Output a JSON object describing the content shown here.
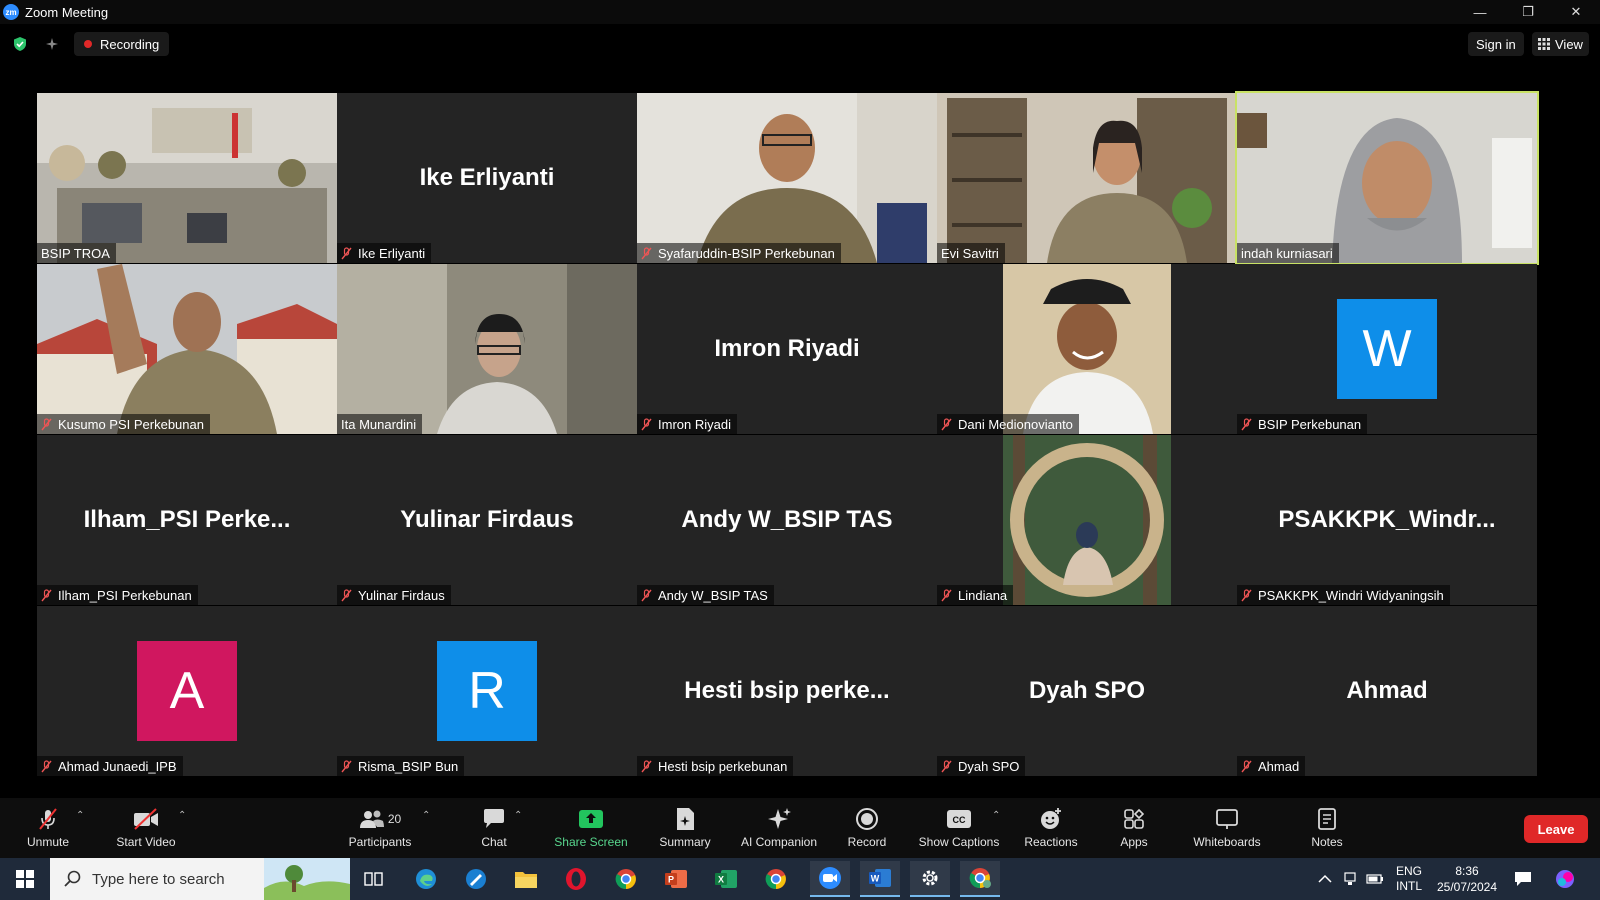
{
  "window": {
    "logo_text": "zm",
    "title": "Zoom Meeting",
    "minimize": "—",
    "restore": "❐",
    "close": "✕"
  },
  "topbar": {
    "security_icon": "shield-check-icon",
    "recording_label": "Recording",
    "sign_in": "Sign in",
    "view_label": "View"
  },
  "colors": {
    "active_speaker_border": "#c9e265",
    "avatar_A": "#d0175f",
    "avatar_blue": "#0e8ee9",
    "leave": "#e02828",
    "share_green": "#22c55e"
  },
  "participants": [
    {
      "name": "BSIP TROA",
      "display": "",
      "muted": false,
      "video": true
    },
    {
      "name": "Ike Erliyanti",
      "display": "Ike Erliyanti",
      "muted": true,
      "video": false
    },
    {
      "name": "Syafaruddin-BSIP Perkebunan",
      "display": "",
      "muted": true,
      "video": true
    },
    {
      "name": "Evi Savitri",
      "display": "",
      "muted": false,
      "video": true
    },
    {
      "name": "indah kurniasari",
      "display": "",
      "muted": false,
      "video": true,
      "active": true
    },
    {
      "name": "Kusumo PSI Perkebunan",
      "display": "",
      "muted": true,
      "video": true
    },
    {
      "name": "Ita Munardini",
      "display": "",
      "muted": false,
      "video": true
    },
    {
      "name": "Imron Riyadi",
      "display": "Imron Riyadi",
      "muted": true,
      "video": false
    },
    {
      "name": "Dani Medionovianto",
      "display": "",
      "muted": true,
      "video": true
    },
    {
      "name": "BSIP Perkebunan",
      "display": "W",
      "muted": true,
      "video": false,
      "avatar": true
    },
    {
      "name": "Ilham_PSI Perkebunan",
      "display": "Ilham_PSI  Perke...",
      "muted": true,
      "video": false
    },
    {
      "name": "Yulinar Firdaus",
      "display": "Yulinar Firdaus",
      "muted": true,
      "video": false
    },
    {
      "name": "Andy W_BSIP TAS",
      "display": "Andy W_BSIP TAS",
      "muted": true,
      "video": false
    },
    {
      "name": "Lindiana",
      "display": "",
      "muted": true,
      "video": true
    },
    {
      "name": "PSAKKPK_Windri Widyaningsih",
      "display": "PSAKKPK_Windr...",
      "muted": true,
      "video": false
    },
    {
      "name": "Ahmad Junaedi_IPB",
      "display": "A",
      "muted": true,
      "video": false,
      "avatar": true
    },
    {
      "name": "Risma_BSIP Bun",
      "display": "R",
      "muted": true,
      "video": false,
      "avatar": true
    },
    {
      "name": "Hesti bsip perkebunan",
      "display": "Hesti  bsip  perke...",
      "muted": true,
      "video": false
    },
    {
      "name": "Dyah SPO",
      "display": "Dyah SPO",
      "muted": true,
      "video": false
    },
    {
      "name": "Ahmad",
      "display": "Ahmad",
      "muted": true,
      "video": false
    }
  ],
  "toolbar": {
    "unmute": "Unmute",
    "start_video": "Start Video",
    "participants": "Participants",
    "participant_count": "20",
    "chat": "Chat",
    "share_screen": "Share Screen",
    "summary": "Summary",
    "ai_companion": "AI Companion",
    "record": "Record",
    "show_captions": "Show Captions",
    "reactions": "Reactions",
    "apps": "Apps",
    "whiteboards": "Whiteboards",
    "notes": "Notes",
    "leave": "Leave"
  },
  "taskbar": {
    "search_placeholder": "Type here to search",
    "lang_line1": "ENG",
    "lang_line2": "INTL",
    "time": "8:36",
    "date": "25/07/2024",
    "apps": [
      "task-view-icon",
      "edge-icon",
      "paint-icon",
      "file-explorer-icon",
      "opera-icon",
      "chrome-icon",
      "powerpoint-icon",
      "excel-icon",
      "chrome-icon",
      "zoom-icon",
      "word-icon",
      "settings-icon",
      "chrome-profile-icon"
    ]
  }
}
